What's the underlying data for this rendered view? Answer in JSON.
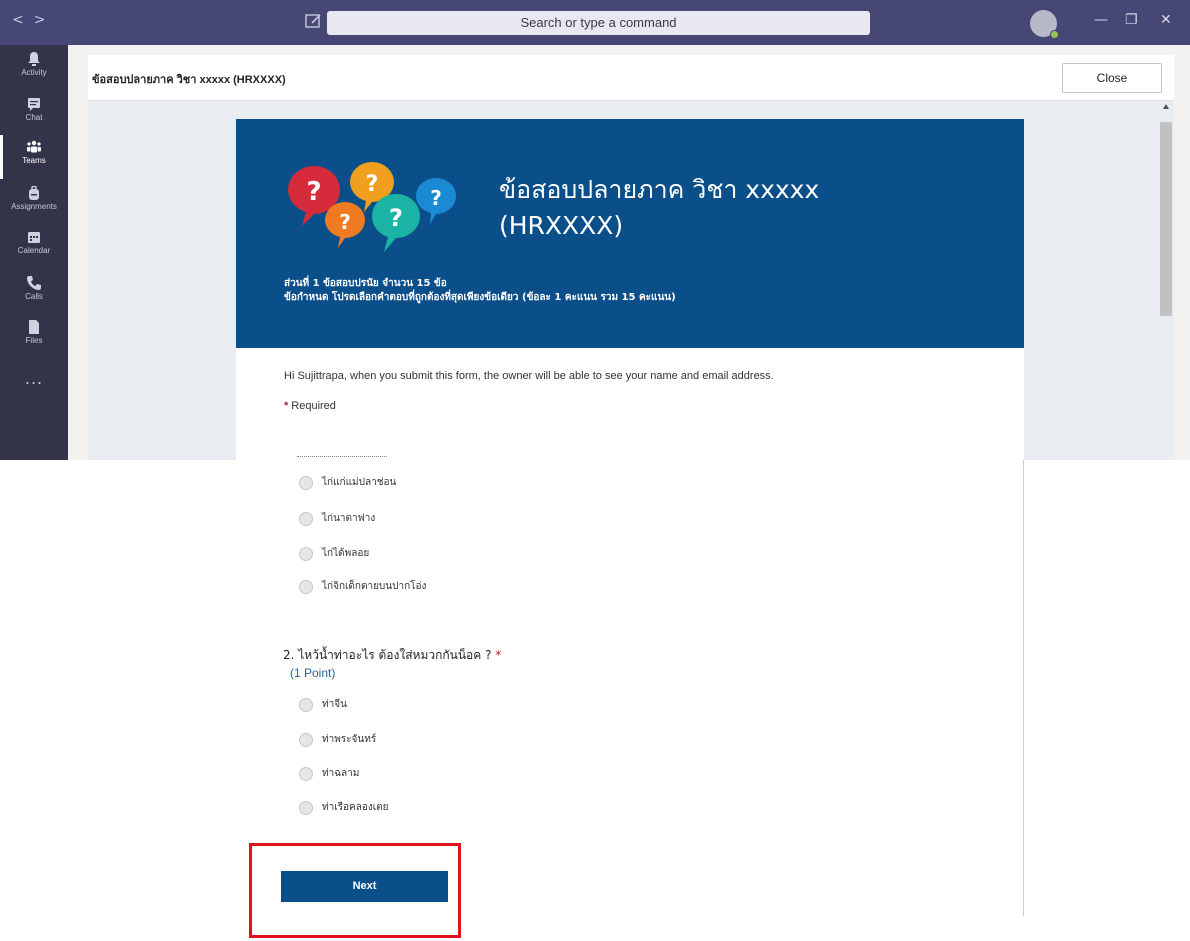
{
  "titlebar": {
    "search_placeholder": "Search or type a command",
    "nav_back_icon": "chevron-left-icon",
    "nav_forward_icon": "chevron-right-icon",
    "window_buttons": [
      "—",
      "❐",
      "✕"
    ],
    "colors": {
      "background": "#464775",
      "status_available": "#92c353"
    }
  },
  "rail": {
    "items": [
      {
        "label": "Activity",
        "icon": "bell-icon"
      },
      {
        "label": "Chat",
        "icon": "chat-icon"
      },
      {
        "label": "Teams",
        "icon": "teams-icon"
      },
      {
        "label": "Assignments",
        "icon": "backpack-icon"
      },
      {
        "label": "Calendar",
        "icon": "calendar-icon"
      },
      {
        "label": "Calls",
        "icon": "phone-icon"
      },
      {
        "label": "Files",
        "icon": "file-icon"
      }
    ],
    "more_label": "...",
    "active": "Teams"
  },
  "header": {
    "title": "ข้อสอบปลายภาค วิชา xxxxx (HRXXXX)",
    "close_label": "Close"
  },
  "form": {
    "banner_title": "ข้อสอบปลายภาค วิชา xxxxx (HRXXXX)",
    "banner_line1": "ส่วนที่ 1 ข้อสอบปรนัย จำนวน 15 ข้อ",
    "banner_line2": "ข้อกำหนด โปรดเลือกคำตอบที่ถูกต้องที่สุดเพียงข้อเดียว (ข้อละ 1 คะแนน รวม 15 คะแนน)",
    "notice": "Hi Sujittrapa, when you submit this form, the owner will be able to see your name and email address.",
    "required_star": "*",
    "required_label": "Required",
    "q1_options": [
      "ไก่แก่แม่ปลาช่อน",
      "ไก่นาตาฟาง",
      "ไก่ได้พลอย",
      "ไก่จิกเด็กตายบนปากโอ่ง"
    ],
    "q2_title": "2. ไหว้น้ำท่าอะไร ต้องใส่หมวกกันน็อค ?",
    "q2_star": "*",
    "q2_points": "(1 Point)",
    "q2_options": [
      "ท่าจีน",
      "ท่าพระจันทร์",
      "ท่าฉลาม",
      "ท่าเรือคลองเตย"
    ],
    "next_label": "Next",
    "colors": {
      "banner": "#0b4f8a",
      "highlight_box": "#e0121a"
    }
  }
}
